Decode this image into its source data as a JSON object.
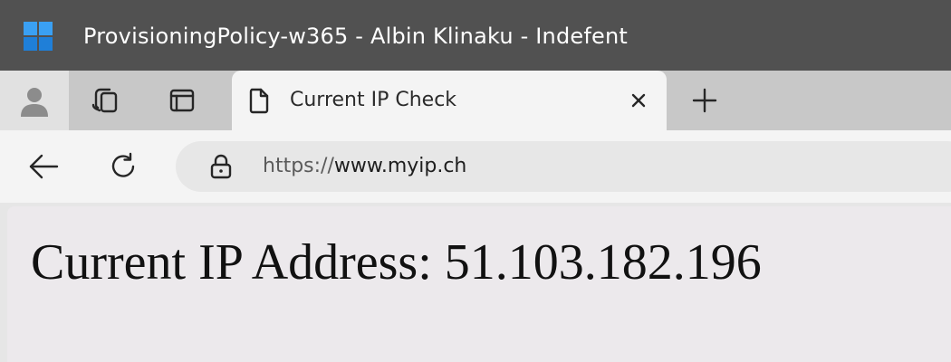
{
  "window": {
    "title": "ProvisioningPolicy-w365 - Albin Klinaku - Indefent",
    "logo_icon": "windows-logo-icon",
    "titlebar_color": "#515151"
  },
  "tabstrip": {
    "profile_icon": "profile-avatar-icon",
    "collections_icon": "collections-icon",
    "workspace_icon": "tab-actions-icon",
    "tabs": [
      {
        "title": "Current IP Check",
        "icon": "page-icon",
        "close_icon": "close-icon"
      }
    ],
    "new_tab_icon": "plus-icon"
  },
  "toolbar": {
    "back_icon": "back-arrow-icon",
    "refresh_icon": "refresh-icon",
    "address": {
      "lock_icon": "lock-icon",
      "scheme": "https://",
      "host": "www.myip.ch"
    }
  },
  "page": {
    "heading": "Current IP Address: 51.103.182.196"
  }
}
